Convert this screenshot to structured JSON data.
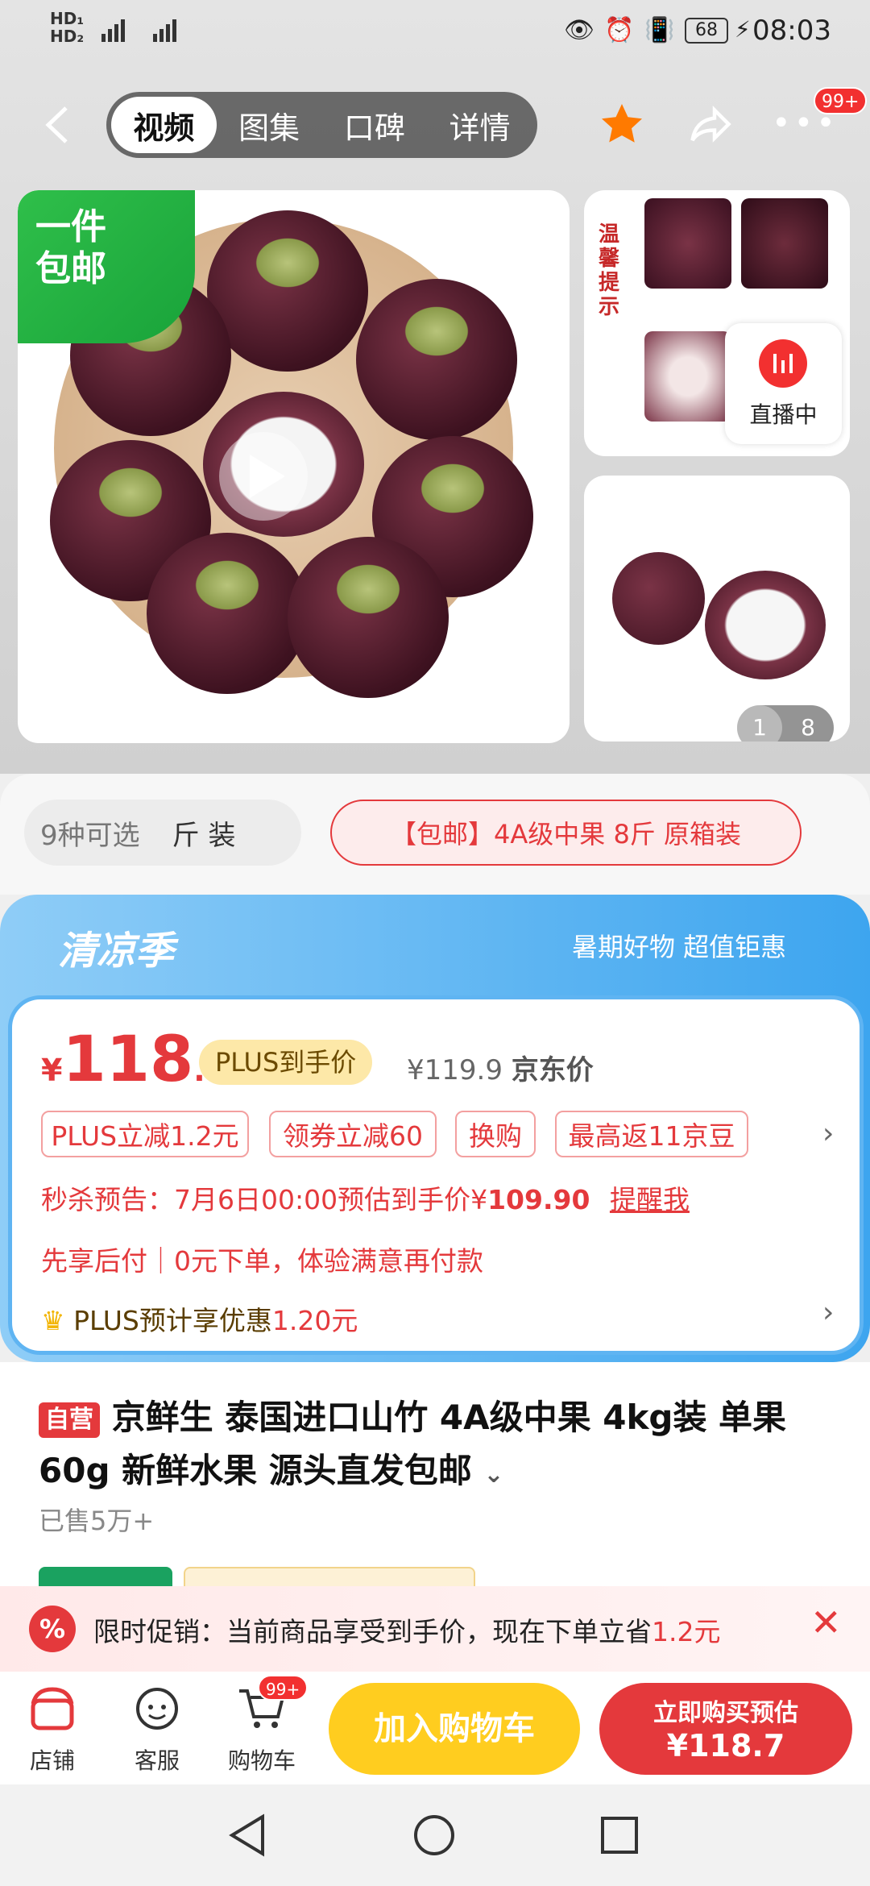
{
  "status_bar": {
    "left": "HD 5G 4G",
    "battery": "68",
    "time": "08:03"
  },
  "header": {
    "tabs": [
      "视频",
      "图集",
      "口碑",
      "详情"
    ],
    "active_tab": "视频",
    "badge": "99+"
  },
  "gallery": {
    "promo_tag": "一件\n包邮",
    "side_text": "温馨提示",
    "live_label": "直播中",
    "page_current": "1",
    "page_total": "8"
  },
  "spec_selector": {
    "count_label": "9种可选",
    "partial_option": "斤 装",
    "selected_option": "【包邮】4A级中果 8斤  原箱装"
  },
  "promo_banner": {
    "title": "清凉季",
    "slogan": "暑期好物 超值钜惠"
  },
  "price": {
    "currency": "¥",
    "integer": "118",
    "decimal": ".7",
    "plus_tag": "PLUS到手价",
    "jd_price": "¥119.9",
    "jd_price_label": "京东价",
    "chips": [
      "PLUS立减1.2元",
      "领券立减60",
      "换购",
      "最高返11京豆"
    ],
    "flash_sale_text": "秒杀预告：7月6日00:00预估到手价¥",
    "flash_sale_price": "109.90",
    "remind_label": "提醒我",
    "pay_later": "先享后付｜0元下单，体验满意再付款",
    "plus_saving_prefix": "PLUS预计享优惠",
    "plus_saving_value": "1.20元"
  },
  "product": {
    "self_tag": "自营",
    "title": "京鲜生 泰国进口山竹 4A级中果 4kg装 单果60g 新鲜水果 源头直发包邮",
    "sold": "已售5万+"
  },
  "limit_promo": {
    "text": "限时促销：当前商品享受到手价，现在下单立省",
    "amount": "1.2元"
  },
  "bottom_bar": {
    "shop": "店铺",
    "service": "客服",
    "cart": "购物车",
    "cart_badge": "99+",
    "add_to_cart": "加入购物车",
    "buy_now": "立即购买预估",
    "buy_price": "¥118.7"
  },
  "colors": {
    "accent_red": "#e4393c",
    "add_cart_yellow": "#ffcd1f",
    "cool_blue": "#3da5ef"
  }
}
